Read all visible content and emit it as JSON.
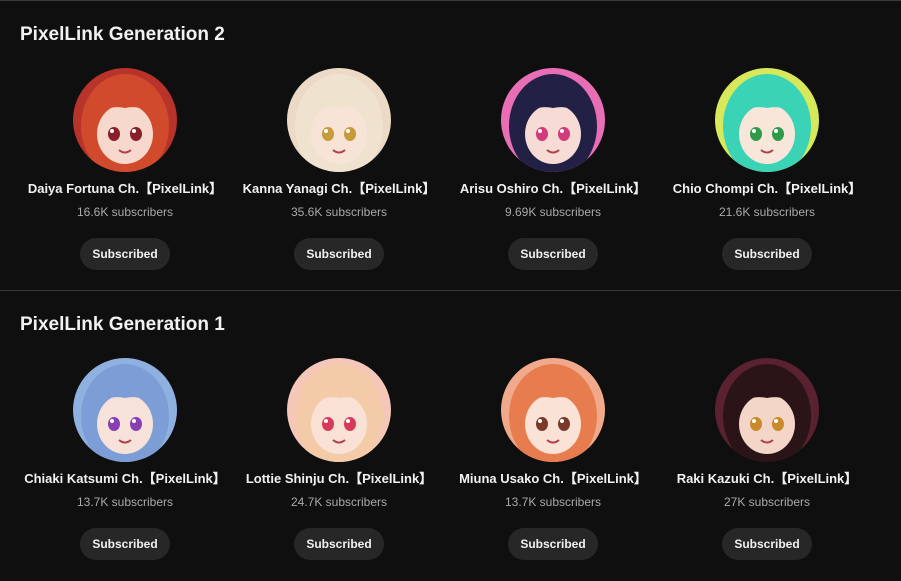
{
  "sections": [
    {
      "title": "PixelLink Generation 2",
      "channels": [
        {
          "name": "Daiya Fortuna Ch.【PixelLink】",
          "subscribers": "16.6K subscribers",
          "button": "Subscribed",
          "colors": {
            "bg": "#b8332a",
            "hair": "#d24a2c",
            "skin": "#f6d9cc",
            "eye": "#8a1f2a"
          }
        },
        {
          "name": "Kanna Yanagi Ch.【PixelLink】",
          "subscribers": "35.6K subscribers",
          "button": "Subscribed",
          "colors": {
            "bg": "#ecd9c6",
            "hair": "#efe3cf",
            "skin": "#f8e4d6",
            "eye": "#c79a3a"
          }
        },
        {
          "name": "Arisu Oshiro Ch.【PixelLink】",
          "subscribers": "9.69K subscribers",
          "button": "Subscribed",
          "colors": {
            "bg": "#e86fb6",
            "hair": "#232046",
            "skin": "#f7dcd6",
            "eye": "#d23a7a"
          }
        },
        {
          "name": "Chio Chompi Ch.【PixelLink】",
          "subscribers": "21.6K subscribers",
          "button": "Subscribed",
          "colors": {
            "bg": "#d7e85a",
            "hair": "#3bd3b5",
            "skin": "#f9e6da",
            "eye": "#2f9a4a"
          }
        }
      ]
    },
    {
      "title": "PixelLink Generation 1",
      "channels": [
        {
          "name": "Chiaki Katsumi Ch.【PixelLink】",
          "subscribers": "13.7K subscribers",
          "button": "Subscribed",
          "colors": {
            "bg": "#8fb1e0",
            "hair": "#7d9dd6",
            "skin": "#f6e2d8",
            "eye": "#8a3fb0"
          }
        },
        {
          "name": "Lottie Shinju Ch.【PixelLink】",
          "subscribers": "24.7K subscribers",
          "button": "Subscribed",
          "colors": {
            "bg": "#f4c7b8",
            "hair": "#f4cba8",
            "skin": "#f9e1d6",
            "eye": "#d63a5a"
          }
        },
        {
          "name": "Miuna Usako Ch.【PixelLink】",
          "subscribers": "13.7K subscribers",
          "button": "Subscribed",
          "colors": {
            "bg": "#f0a98a",
            "hair": "#e77d4e",
            "skin": "#fae3d6",
            "eye": "#7a3a2a"
          }
        },
        {
          "name": "Raki Kazuki Ch.【PixelLink】",
          "subscribers": "27K subscribers",
          "button": "Subscribed",
          "colors": {
            "bg": "#5a2230",
            "hair": "#2a1418",
            "skin": "#f3d6c8",
            "eye": "#c98a2a"
          }
        }
      ]
    }
  ]
}
